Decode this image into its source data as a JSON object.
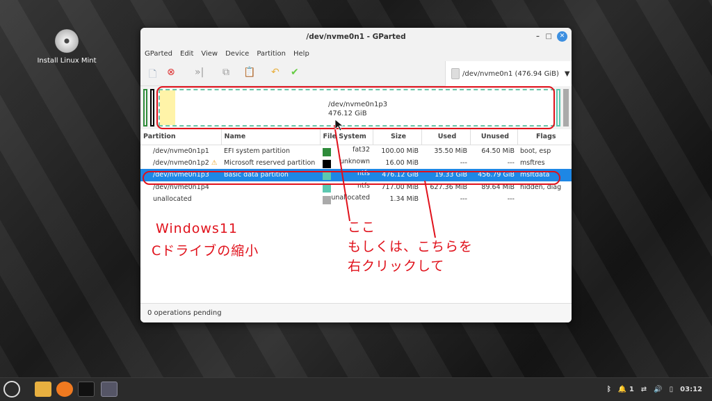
{
  "desktop": {
    "icon_label": "Install Linux Mint"
  },
  "window": {
    "title": "/dev/nvme0n1 - GParted"
  },
  "menu": [
    "GParted",
    "Edit",
    "View",
    "Device",
    "Partition",
    "Help"
  ],
  "device_selector": "/dev/nvme0n1 (476.94 GiB)",
  "graph": {
    "name": "/dev/nvme0n1p3",
    "size": "476.12 GiB"
  },
  "table": {
    "headers": [
      "Partition",
      "Name",
      "File System",
      "Size",
      "Used",
      "Unused",
      "Flags"
    ],
    "rows": [
      {
        "partition": "/dev/nvme0n1p1",
        "name": "EFI system partition",
        "fs": "fat32",
        "color": "#2e8b3a",
        "size": "100.00 MiB",
        "used": "35.50 MiB",
        "unused": "64.50 MiB",
        "flags": "boot, esp"
      },
      {
        "partition": "/dev/nvme0n1p2",
        "name": "Microsoft reserved partition",
        "fs": "unknown",
        "color": "#000000",
        "size": "16.00 MiB",
        "used": "---",
        "unused": "---",
        "flags": "msftres",
        "warning": true
      },
      {
        "partition": "/dev/nvme0n1p3",
        "name": "Basic data partition",
        "fs": "ntfs",
        "color": "#5cc8b0",
        "size": "476.12 GiB",
        "used": "19.33 GiB",
        "unused": "456.79 GiB",
        "flags": "msftdata",
        "selected": true
      },
      {
        "partition": "/dev/nvme0n1p4",
        "name": "",
        "fs": "ntfs",
        "color": "#5cc8b0",
        "size": "717.00 MiB",
        "used": "627.36 MiB",
        "unused": "89.64 MiB",
        "flags": "hidden, diag"
      },
      {
        "partition": "unallocated",
        "name": "",
        "fs": "unallocated",
        "color": "#aaaaaa",
        "size": "1.34 MiB",
        "used": "---",
        "unused": "---",
        "flags": ""
      }
    ]
  },
  "status": "0 operations pending",
  "annotations": {
    "left1": "Windows11",
    "left2": "Cドライブの縮小",
    "right1": "ここ",
    "right2": "もしくは、こちらを",
    "right3": "右クリックして"
  },
  "tray": {
    "notifications": "1",
    "clock": "03:12"
  }
}
